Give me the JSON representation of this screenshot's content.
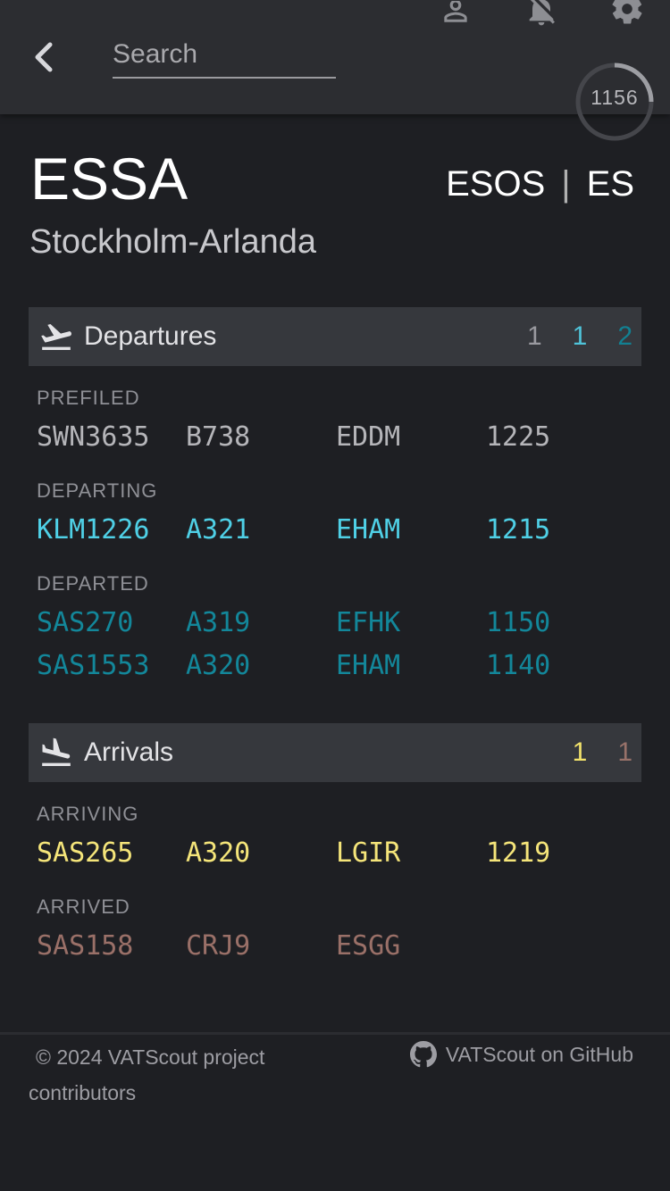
{
  "topbar": {
    "search_placeholder": "Search",
    "back_icon": "chevron-left-icon",
    "icons": [
      "account-icon",
      "notifications-off-icon",
      "gear-icon"
    ],
    "time": "1156"
  },
  "airport": {
    "icao": "ESSA",
    "fir": "ESOS",
    "separator": "|",
    "country": "ES",
    "name": "Stockholm-Arlanda"
  },
  "departures": {
    "title": "Departures",
    "counts": [
      {
        "value": "1",
        "color": "#9a9aa0"
      },
      {
        "value": "1",
        "color": "#4fc3d9"
      },
      {
        "value": "2",
        "color": "#128092"
      }
    ],
    "groups": [
      {
        "label": "PREFILED",
        "color": "#b5b5b9",
        "rows": [
          {
            "callsign": "SWN3635",
            "aircraft": "B738",
            "dest": "EDDM",
            "time": "1225"
          }
        ]
      },
      {
        "label": "DEPARTING",
        "color": "#4fd0e6",
        "rows": [
          {
            "callsign": "KLM1226",
            "aircraft": "A321",
            "dest": "EHAM",
            "time": "1215"
          }
        ]
      },
      {
        "label": "DEPARTED",
        "color": "#13879a",
        "rows": [
          {
            "callsign": "SAS270",
            "aircraft": "A319",
            "dest": "EFHK",
            "time": "1150"
          },
          {
            "callsign": "SAS1553",
            "aircraft": "A320",
            "dest": "EHAM",
            "time": "1140"
          }
        ]
      }
    ]
  },
  "arrivals": {
    "title": "Arrivals",
    "counts": [
      {
        "value": "1",
        "color": "#f2e26b"
      },
      {
        "value": "1",
        "color": "#98726a"
      }
    ],
    "groups": [
      {
        "label": "ARRIVING",
        "color": "#f5e57a",
        "rows": [
          {
            "callsign": "SAS265",
            "aircraft": "A320",
            "dest": "LGIR",
            "time": "1219"
          }
        ]
      },
      {
        "label": "ARRIVED",
        "color": "#9a7068",
        "rows": [
          {
            "callsign": "SAS158",
            "aircraft": "CRJ9",
            "dest": "ESGG",
            "time": ""
          }
        ]
      }
    ]
  },
  "footer": {
    "copyright": "© 2024 VATScout project contributors",
    "github_label": "VATScout on GitHub",
    "github_icon": "github-icon"
  }
}
